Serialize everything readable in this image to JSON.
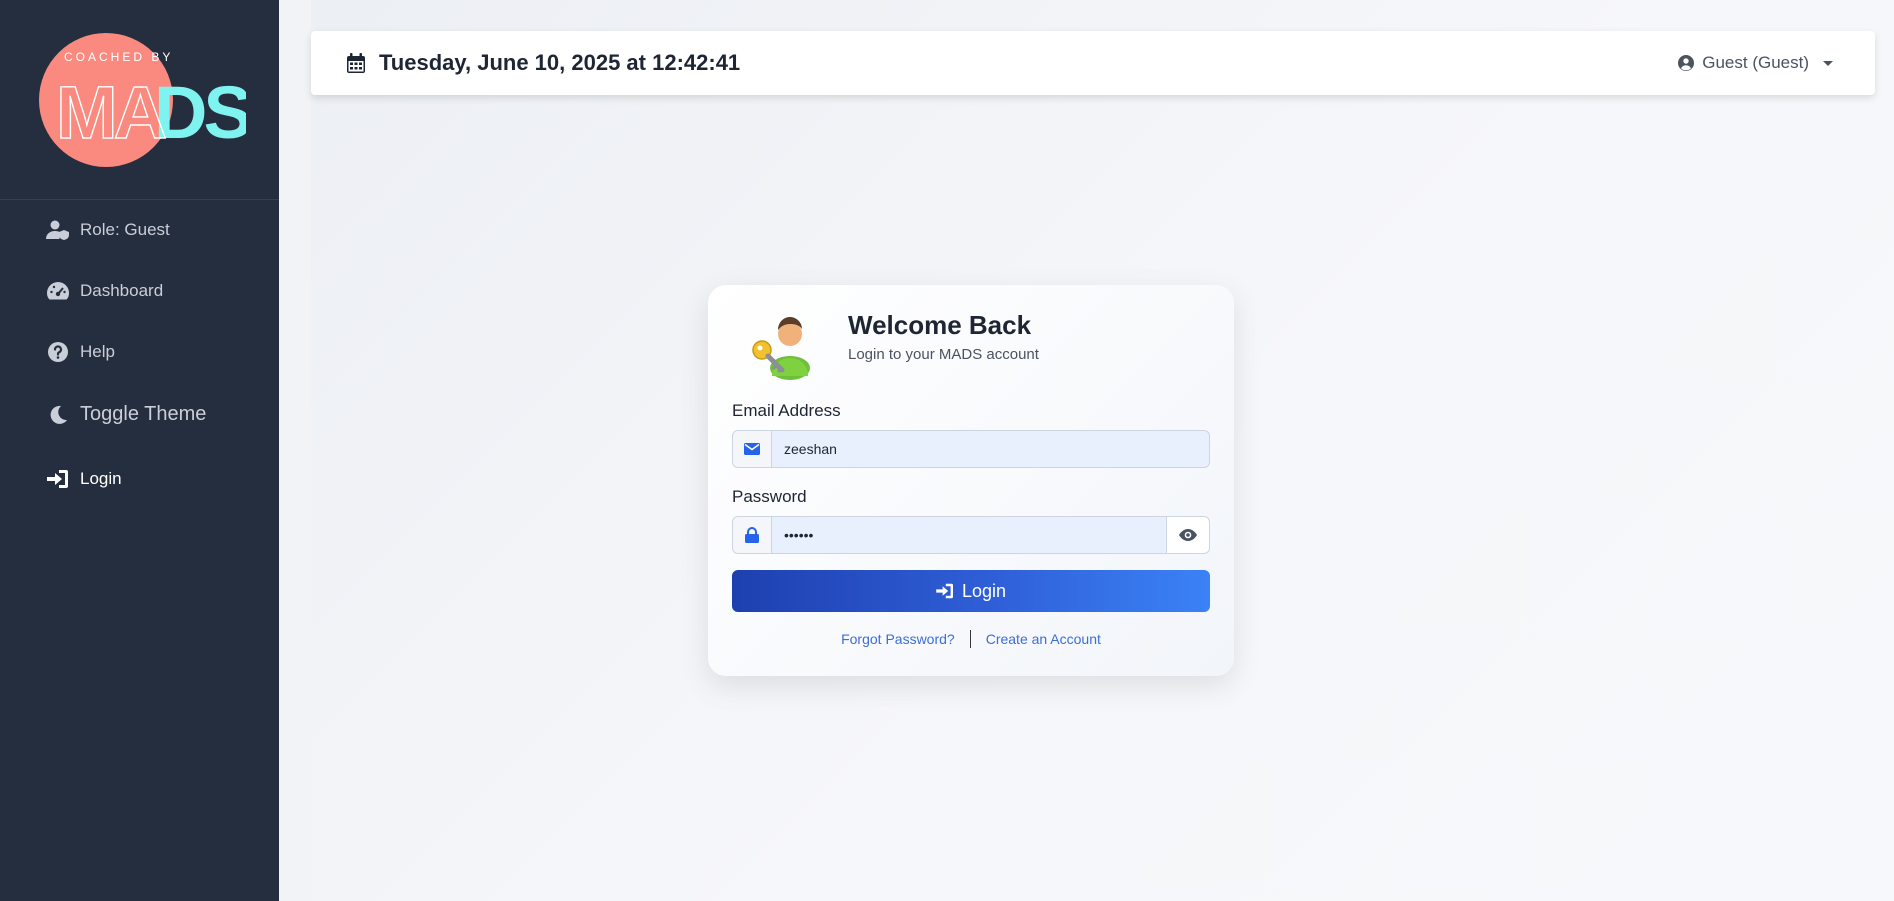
{
  "brand": {
    "logo_small_text": "COACHED BY",
    "logo_big_text": "MADS",
    "colors": {
      "circle": "#fa8a80",
      "cyan": "#7ff3f0"
    }
  },
  "sidebar": {
    "items": [
      {
        "label": "Role: Guest",
        "icon": "user-shield-icon"
      },
      {
        "label": "Dashboard",
        "icon": "speedometer-icon"
      },
      {
        "label": "Help",
        "icon": "question-circle-icon"
      },
      {
        "label": "Toggle Theme",
        "icon": "moon-icon"
      },
      {
        "label": "Login",
        "icon": "sign-in-icon"
      }
    ]
  },
  "header": {
    "datetime": "Tuesday, June 10, 2025 at 12:42:41",
    "user_label": "Guest (Guest)"
  },
  "login_card": {
    "title": "Welcome Back",
    "subtitle": "Login to your MADS account",
    "email_label": "Email Address",
    "email_value": "zeeshan",
    "password_label": "Password",
    "password_value": "••••••",
    "submit_label": "Login",
    "forgot_label": "Forgot Password?",
    "create_label": "Create an Account"
  },
  "colors": {
    "sidebar_bg": "#252e3e",
    "accent": "#2563eb",
    "link": "#3b6fd8"
  }
}
